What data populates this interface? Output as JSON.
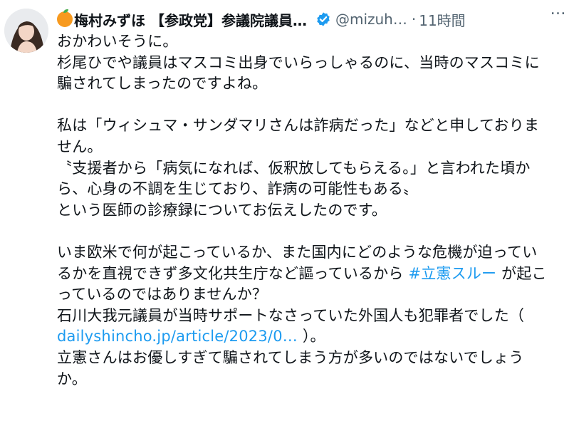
{
  "author": {
    "emoji": "🍊",
    "display_name": "梅村みずほ 【参政党】参議院議員…",
    "handle": "@mizuh…",
    "separator": "·",
    "time": "11時間",
    "avatar_icon": "user-avatar-icon",
    "badge_icon": "verified-badge-icon",
    "more_icon": "more-options-icon",
    "badge_color": "#1d9bf0",
    "link_color": "#1d9bf0",
    "more_label": "…"
  },
  "body": {
    "p1": "おかわいそうに。",
    "p2": "杉尾ひでや議員はマスコミ出身でいらっしゃるのに、当時のマスコミに騙されてしまったのですよね。",
    "p3": "私は「ウィシュマ・サンダマリさんは詐病だった」などと申しておりません。",
    "p4": "〝支援者から「病気になれば、仮釈放してもらえる。」と言われた頃から、心身の不調を生じており、詐病の可能性もある〟",
    "p5": "という医師の診療録についてお伝えしたのです。",
    "p6a": "いま欧米で何が起こっているか、また国内にどのような危機が迫っているかを直視できず多文化共生庁など謳っているから ",
    "hashtag": "#立憲スルー",
    "p6b": " が起こっているのではありませんか？",
    "p7": "石川大我元議員が当時サポートなさっていた外国人も犯罪者でした（ ",
    "url": "dailyshincho.jp/article/2023/0…",
    "p7b": " ）。",
    "p8": "立憲さんはお優しすぎて騙されてしまう方が多いのではないでしょうか。"
  }
}
